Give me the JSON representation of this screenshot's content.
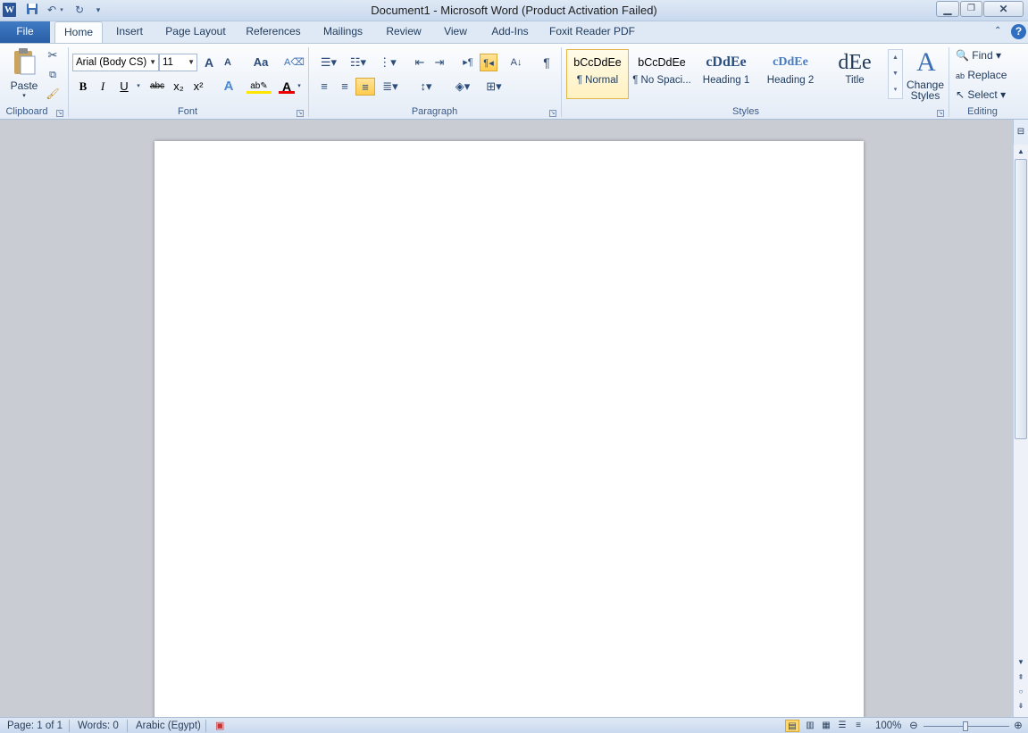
{
  "window": {
    "title": "Document1  -  Microsoft Word (Product Activation Failed)",
    "app_icon": "W"
  },
  "qat": {
    "save_icon": "save-icon",
    "undo_icon": "undo-icon",
    "redo_icon": "redo-icon"
  },
  "tabs": [
    "File",
    "Home",
    "Insert",
    "Page Layout",
    "References",
    "Mailings",
    "Review",
    "View",
    "Add-Ins",
    "Foxit Reader PDF"
  ],
  "clipboard": {
    "paste_label": "Paste",
    "group_label": "Clipboard"
  },
  "font": {
    "font_name": "Arial (Body CS)",
    "font_size": "11",
    "group_label": "Font",
    "grow": "A",
    "shrink": "A",
    "change_case": "Aa",
    "bold": "B",
    "italic": "I",
    "underline": "U",
    "strike": "abc",
    "subscript": "x₂",
    "superscript": "x²",
    "effects": "A",
    "color": "A"
  },
  "paragraph": {
    "group_label": "Paragraph",
    "pilcrow": "¶"
  },
  "styles": {
    "group_label": "Styles",
    "items": [
      {
        "sample": "bCcDdEe",
        "name": "¶ Normal"
      },
      {
        "sample": "bCcDdEe",
        "name": "¶ No Spaci..."
      },
      {
        "sample": "cDdEe",
        "name": "Heading 1"
      },
      {
        "sample": "cDdEe",
        "name": "Heading 2"
      },
      {
        "sample": "dEe",
        "name": "Title"
      }
    ],
    "change_styles": "Change Styles"
  },
  "editing": {
    "group_label": "Editing",
    "find": "Find",
    "replace": "Replace",
    "select": "Select"
  },
  "status": {
    "page": "Page: 1 of 1",
    "words": "Words: 0",
    "language": "Arabic (Egypt)",
    "zoom": "100%"
  },
  "colors": {
    "accent": "#2a5fa7",
    "ribbon": "#e4ecf7",
    "selected_style": "#e3b44a"
  }
}
